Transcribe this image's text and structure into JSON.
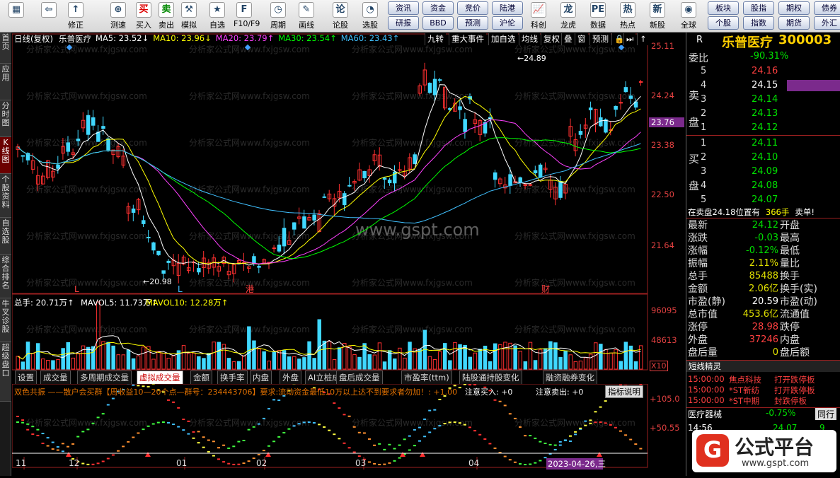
{
  "toolbar": {
    "icons": [
      "",
      "",
      "修正",
      "测速",
      "买入",
      "卖出",
      "模拟",
      "自选",
      "F10/F9",
      "周期",
      "画线",
      "论股",
      "选股",
      "科创",
      "龙虎",
      "数据",
      "热点",
      "新股",
      "全球"
    ],
    "buttons_row1": [
      "资讯",
      "资金",
      "竞价",
      "陆港",
      "板块",
      "股指",
      "期权",
      "债券"
    ],
    "buttons_row2": [
      "研报",
      "BBD",
      "预测",
      "沪伦",
      "个股",
      "指数",
      "期货",
      "外汇"
    ]
  },
  "sidebar": [
    "首页",
    "应用",
    "分时图",
    "K线图",
    "个股资料",
    "自选股",
    "综合排名",
    "牛叉诊股",
    "超级盘口"
  ],
  "kline": {
    "title": "日线(复权)",
    "stock": "乐普医疗",
    "ma": [
      {
        "label": "MA5: 23.52↓",
        "color": "#ffffff"
      },
      {
        "label": "MA10: 23.96↓",
        "color": "#ffff00"
      },
      {
        "label": "MA20: 23.79↑",
        "color": "#ff40ff"
      },
      {
        "label": "MA30: 23.54↑",
        "color": "#00ff00"
      },
      {
        "label": "MA60: 23.43↑",
        "color": "#40c0ff"
      }
    ],
    "functions": [
      "九转",
      "重大事件",
      "加自选",
      "均线",
      "复权",
      "叠",
      "窗",
      "预测",
      "🔒",
      "⏭",
      "↑"
    ],
    "y_ticks": [
      "25.11",
      "24.24",
      "23.76",
      "23.38",
      "22.50",
      "21.64"
    ],
    "high_label": "24.89",
    "low_label": "20.98",
    "markers": [
      "L",
      "L",
      "港",
      "财"
    ],
    "watermark": "www.gspt.com",
    "watermark_text": "分析家公式网www.fxjgsw.com"
  },
  "volume": {
    "label": "总手: 20.71万↑",
    "mavol5": "MAVOL5: 11.73万↑",
    "mavol10": "MAVOL10: 12.28万↑",
    "y_ticks": [
      "96095",
      "48613"
    ],
    "unit": "X10"
  },
  "tabs": [
    "设置",
    "成交量",
    "多周期成交量",
    "虚拟成交量",
    "金额",
    "换手率",
    "内盘",
    "外盘",
    "AI立桩成交量",
    "盘后成交量",
    "市盈率(ttm)",
    "陆股通持股变化",
    "融资融券变化"
  ],
  "active_tab": "虚拟成交量",
  "indicator": {
    "title": "双色共振 ——散户会买群【周收益10—20个点—群号：234443706】要求:流动资金最低10万以上达不到要求者勿加！: +1.00",
    "buy": "注意买入: +0",
    "sell": "注意卖出: +0",
    "button": "指标说明",
    "y_ticks": [
      "+105.0",
      "+50.55"
    ]
  },
  "x_axis": [
    "11",
    "12",
    "01",
    "02",
    "03",
    "04"
  ],
  "date_badge": "2023-04-26,三",
  "right": {
    "code_header": "R",
    "name": "乐普医疗",
    "code": "300003",
    "webi_label": "委比",
    "webi_value": "-90.31%",
    "sell_label": "卖盘",
    "buy_label": "买盘",
    "asks": [
      {
        "lv": "5",
        "p": "24.16",
        "v": ""
      },
      {
        "lv": "4",
        "p": "24.15",
        "v": ""
      },
      {
        "lv": "3",
        "p": "24.14",
        "v": ""
      },
      {
        "lv": "2",
        "p": "24.13",
        "v": ""
      },
      {
        "lv": "1",
        "p": "24.12",
        "v": ""
      }
    ],
    "bids": [
      {
        "lv": "1",
        "p": "24.11",
        "v": ""
      },
      {
        "lv": "2",
        "p": "24.10",
        "v": ""
      },
      {
        "lv": "3",
        "p": "24.09",
        "v": ""
      },
      {
        "lv": "4",
        "p": "24.08",
        "v": ""
      },
      {
        "lv": "5",
        "p": "24.07",
        "v": ""
      }
    ],
    "note": "在卖盘24.18位置有",
    "note_vol": "366手",
    "note_tail": "卖单!",
    "stats": [
      {
        "l": "最新",
        "v": "24.12",
        "c": "green",
        "r": "开盘"
      },
      {
        "l": "涨跌",
        "v": "-0.03",
        "c": "green",
        "r": "最高"
      },
      {
        "l": "涨幅",
        "v": "-0.12%",
        "c": "green",
        "r": "最低"
      },
      {
        "l": "振幅",
        "v": "2.11%",
        "c": "yellow",
        "r": "量比"
      },
      {
        "l": "总手",
        "v": "85488",
        "c": "yellow",
        "r": "换手"
      },
      {
        "l": "金额",
        "v": "2.06亿",
        "c": "yellow",
        "r": "换手(实)"
      },
      {
        "l": "市盈(静)",
        "v": "20.59",
        "c": "white",
        "r": "市盈(动)"
      },
      {
        "l": "总市值",
        "v": "453.6亿",
        "c": "yellow",
        "r": "流通值"
      },
      {
        "l": "涨停",
        "v": "28.98",
        "c": "red",
        "r": "跌停"
      },
      {
        "l": "外盘",
        "v": "37246",
        "c": "red",
        "r": "内盘"
      },
      {
        "l": "盘后量",
        "v": "0",
        "c": "yellow",
        "r": "盘后额"
      }
    ],
    "elf_title": "短线精灵",
    "elf": [
      {
        "t": "15:00:00",
        "n": "焦点科技",
        "s": "打开跌停板"
      },
      {
        "t": "15:00:00",
        "n": "*ST新纺",
        "s": "打开跌停板"
      },
      {
        "t": "15:00:00",
        "n": "*ST中期",
        "s": "封跌停板"
      }
    ],
    "sector": "医疗器械",
    "sector_chg": "-0.75%",
    "sector_tab": "同行",
    "tick_time": "14:56",
    "tick_price": "24.07",
    "tick_vol": "9"
  },
  "logo": {
    "text": "公式平台",
    "url": "www.gspt.com"
  }
}
